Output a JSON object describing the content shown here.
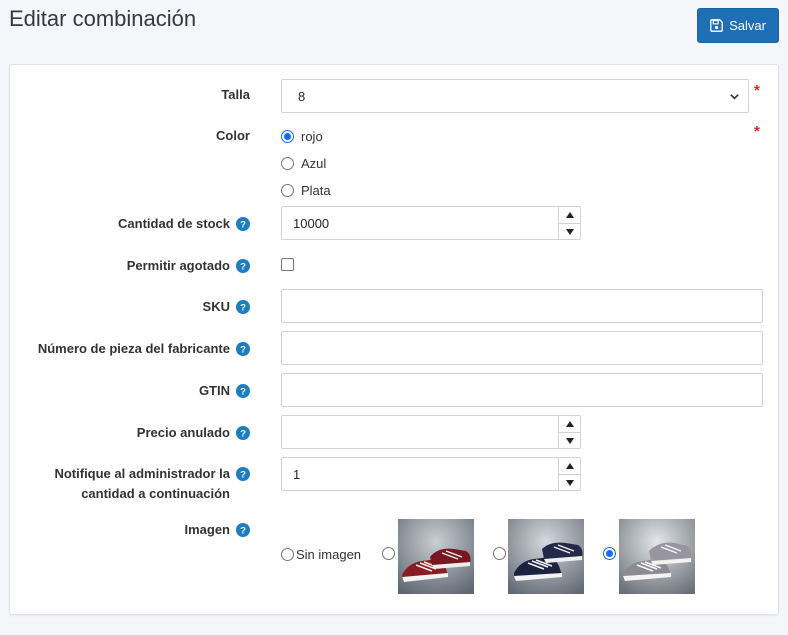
{
  "page": {
    "title": "Editar combinación"
  },
  "toolbar": {
    "save_label": "Salvar",
    "save_icon": "floppy-disk-icon"
  },
  "colors": {
    "accent": "#1e6fb6",
    "help": "#1b7ec2",
    "required": "#e02424",
    "radio_selected": "#0d6efd"
  },
  "form": {
    "talla": {
      "label": "Talla",
      "value": "8",
      "required": true,
      "required_mark": "*"
    },
    "color": {
      "label": "Color",
      "required": true,
      "required_mark": "*",
      "options": [
        {
          "label": "rojo",
          "selected": true
        },
        {
          "label": "Azul",
          "selected": false
        },
        {
          "label": "Plata",
          "selected": false
        }
      ]
    },
    "stock": {
      "label": "Cantidad de stock",
      "value": "10000"
    },
    "allow_out_of_stock": {
      "label": "Permitir agotado",
      "checked": false
    },
    "sku": {
      "label": "SKU",
      "value": ""
    },
    "mpn": {
      "label": "Número de pieza del fabricante",
      "value": ""
    },
    "gtin": {
      "label": "GTIN",
      "value": ""
    },
    "override_price": {
      "label": "Precio anulado",
      "value": ""
    },
    "notify_admin": {
      "label_line1": "Notifique al administrador la",
      "label_line2": "cantidad a continuación",
      "value": "1"
    },
    "image": {
      "label": "Imagen",
      "no_image_label": "Sin imagen",
      "options": [
        {
          "name": "red-sneakers",
          "selected": false
        },
        {
          "name": "navy-sneakers",
          "selected": false
        },
        {
          "name": "grey-sneakers",
          "selected": true
        }
      ]
    }
  }
}
